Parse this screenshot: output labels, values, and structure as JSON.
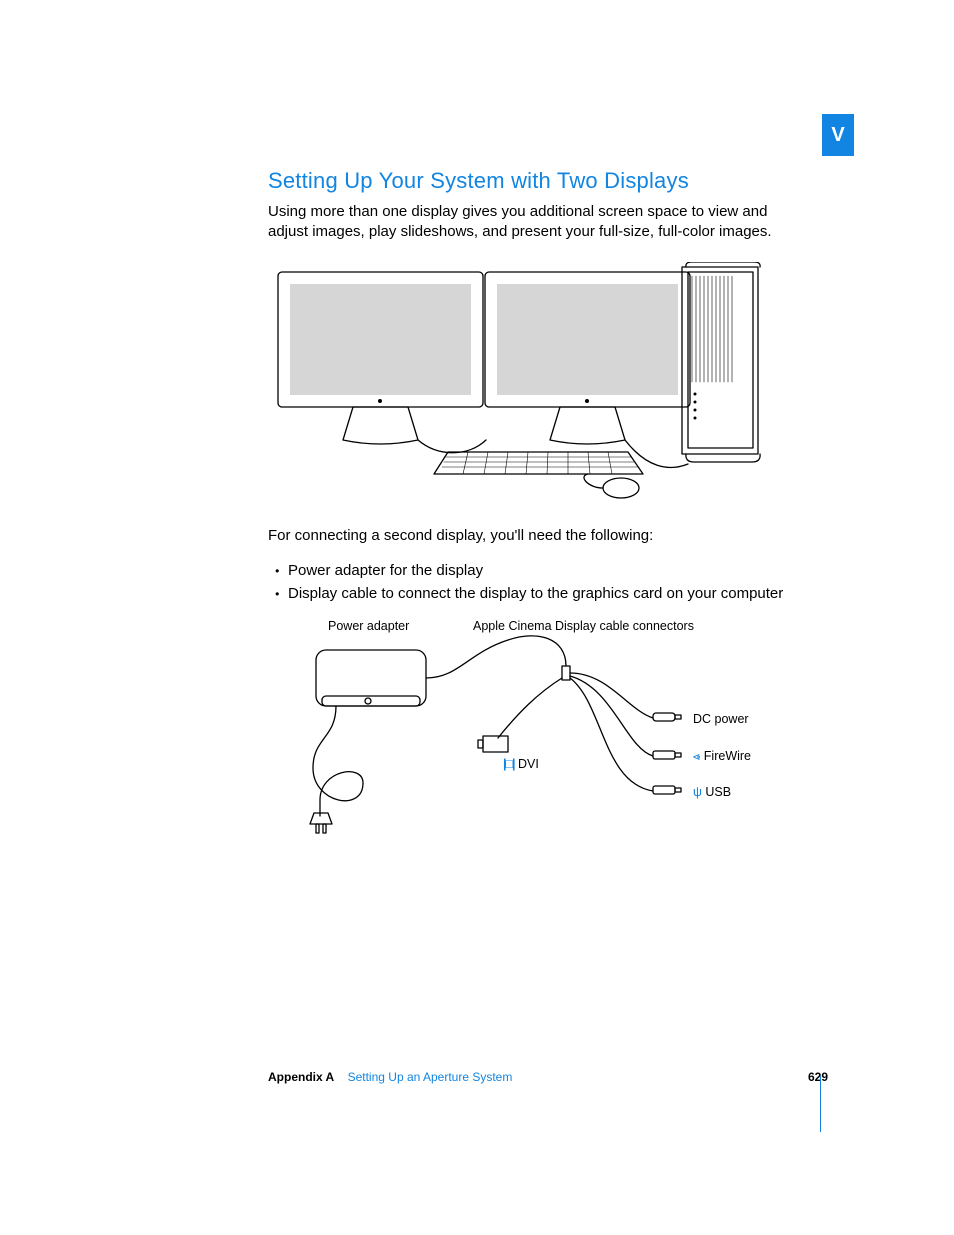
{
  "tab_letter": "V",
  "heading": "Setting Up Your System with Two Displays",
  "intro": "Using more than one display gives you additional screen space to view and adjust images, play slideshows, and present your full-size, full-color images.",
  "para2": "For connecting a second display, you'll need the following:",
  "bullets": [
    "Power adapter for the display",
    "Display cable to connect the display to the graphics card on your computer"
  ],
  "diagram": {
    "left_label": "Power adapter",
    "right_label": "Apple Cinema Display cable connectors",
    "connectors": {
      "dvi": "DVI",
      "dc": "DC power",
      "firewire": "FireWire",
      "usb": "USB"
    }
  },
  "footer": {
    "appendix": "Appendix A",
    "title": "Setting Up an Aperture System",
    "page": "629"
  }
}
